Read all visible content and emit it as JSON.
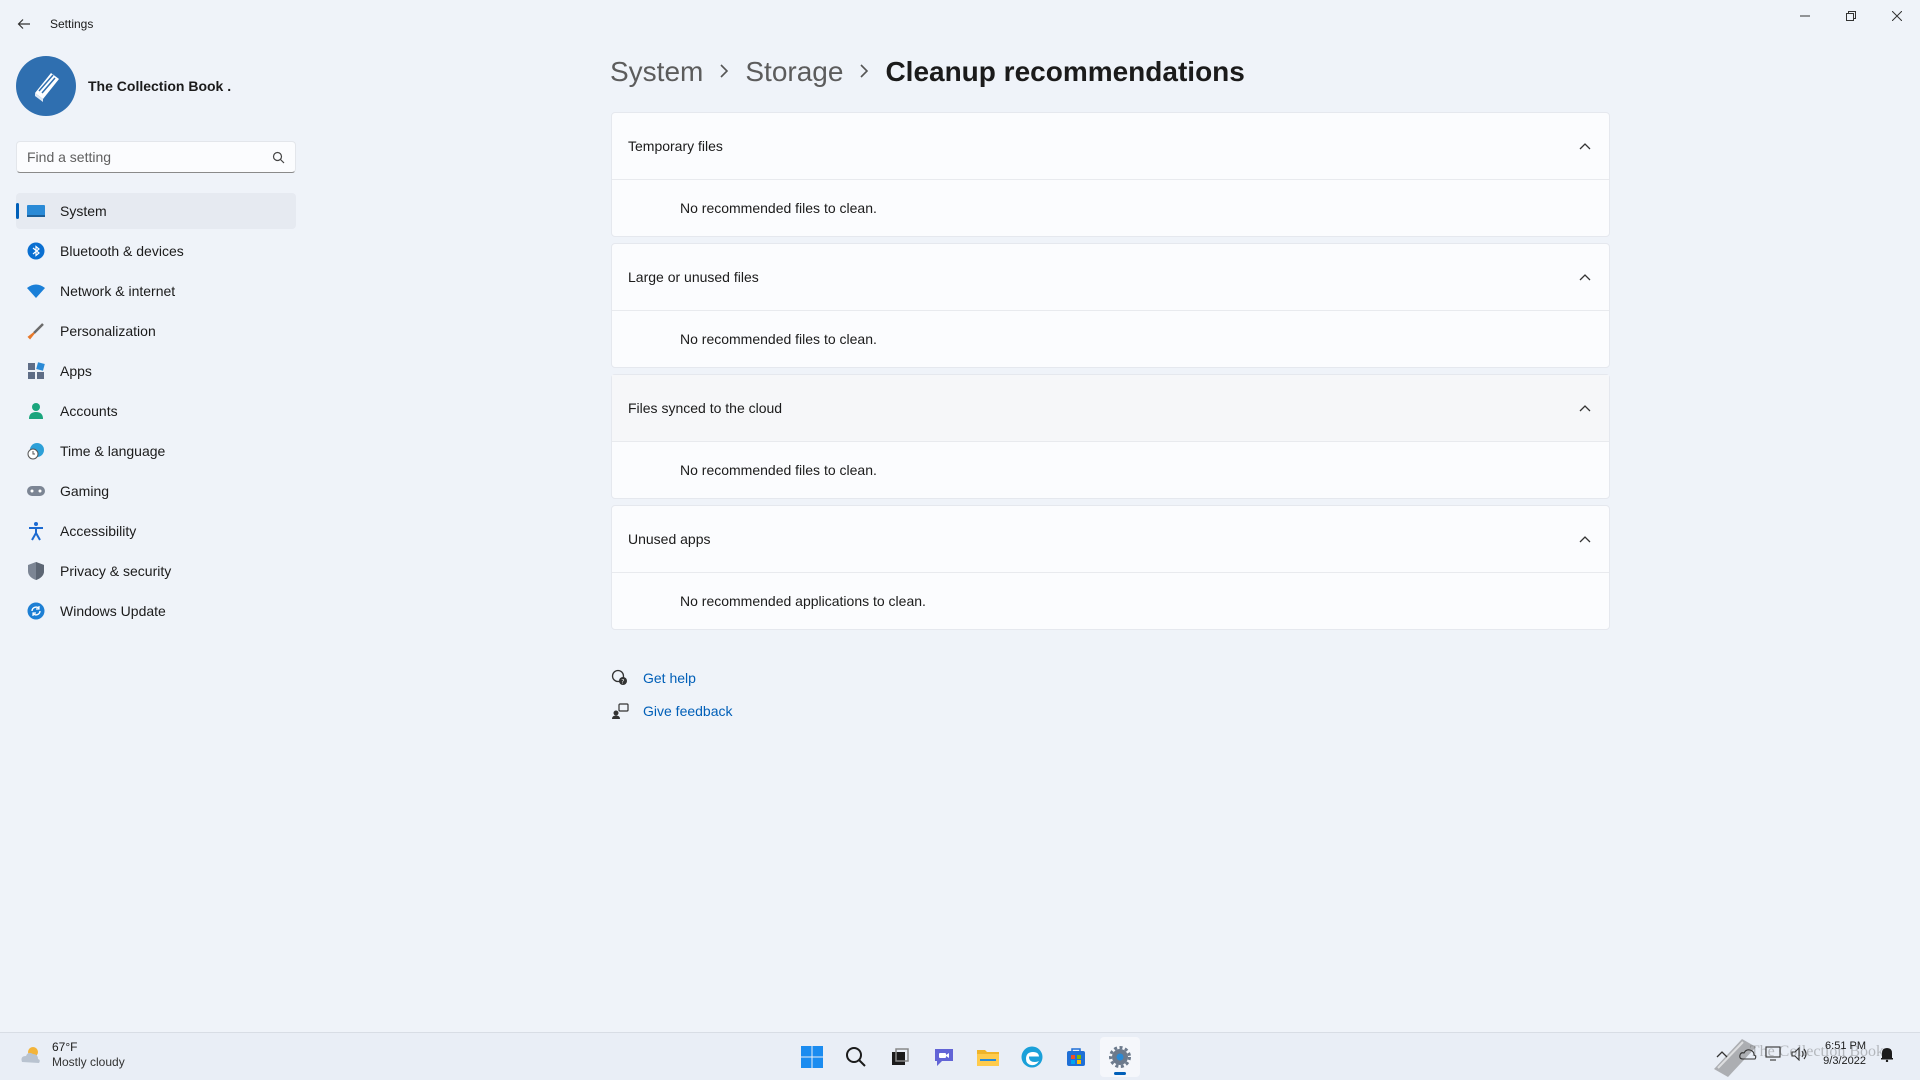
{
  "window": {
    "title": "Settings"
  },
  "profile": {
    "name": "The Collection Book ."
  },
  "search": {
    "placeholder": "Find a setting"
  },
  "nav": {
    "items": [
      {
        "label": "System",
        "icon": "monitor-icon",
        "active": true
      },
      {
        "label": "Bluetooth & devices",
        "icon": "bluetooth-icon"
      },
      {
        "label": "Network & internet",
        "icon": "wifi-icon"
      },
      {
        "label": "Personalization",
        "icon": "brush-icon"
      },
      {
        "label": "Apps",
        "icon": "apps-icon"
      },
      {
        "label": "Accounts",
        "icon": "person-icon"
      },
      {
        "label": "Time & language",
        "icon": "globe-clock-icon"
      },
      {
        "label": "Gaming",
        "icon": "gamepad-icon"
      },
      {
        "label": "Accessibility",
        "icon": "accessibility-icon"
      },
      {
        "label": "Privacy & security",
        "icon": "shield-icon"
      },
      {
        "label": "Windows Update",
        "icon": "update-icon"
      }
    ]
  },
  "breadcrumb": {
    "level1": "System",
    "level2": "Storage",
    "current": "Cleanup recommendations"
  },
  "sections": [
    {
      "title": "Temporary files",
      "message": "No recommended files to clean."
    },
    {
      "title": "Large or unused files",
      "message": "No recommended files to clean."
    },
    {
      "title": "Files synced to the cloud",
      "message": "No recommended files to clean."
    },
    {
      "title": "Unused apps",
      "message": "No recommended applications to clean."
    }
  ],
  "help": {
    "get_help": "Get help",
    "give_feedback": "Give feedback"
  },
  "taskbar": {
    "weather_temp": "67°F",
    "weather_desc": "Mostly cloudy",
    "time": "6:51 PM",
    "date": "9/3/2022",
    "watermark": "The Collection Book"
  },
  "colors": {
    "accent": "#005fb8",
    "background": "#eff3f9",
    "card": "#fbfcfe"
  }
}
